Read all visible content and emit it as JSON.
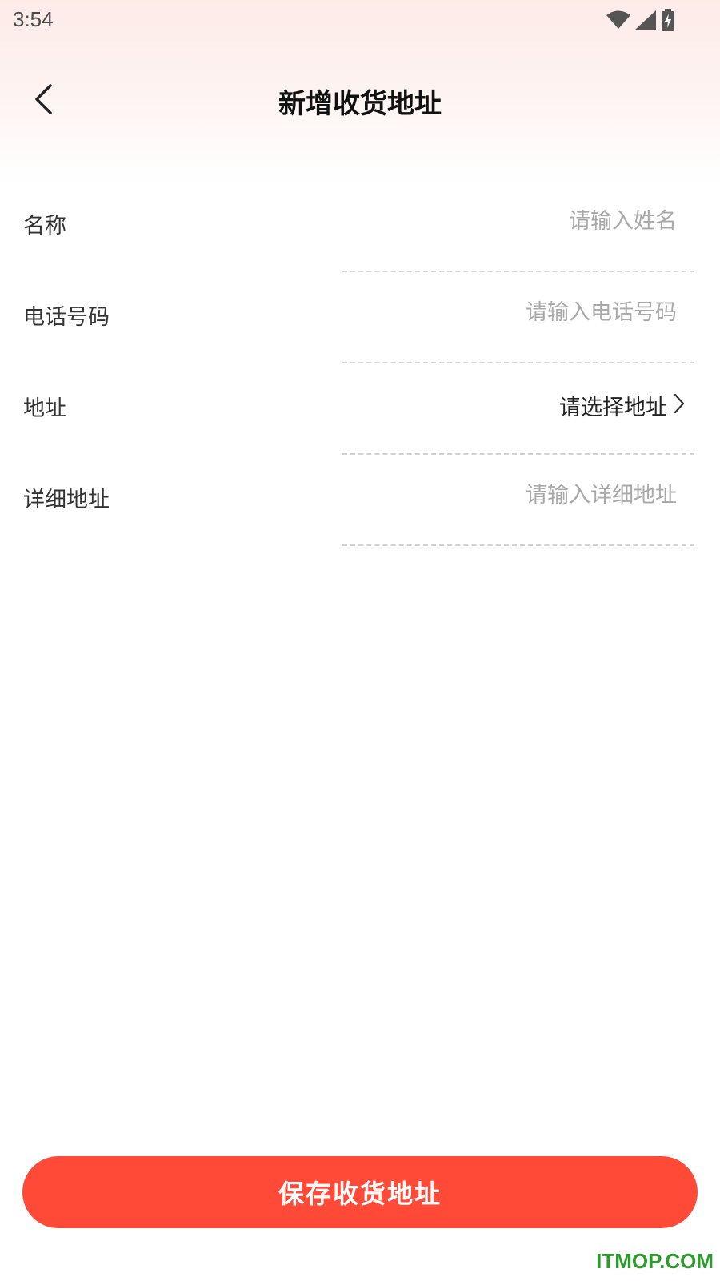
{
  "status_bar": {
    "time": "3:54",
    "icons": [
      "wifi-icon",
      "signal-icon",
      "battery-charging-icon"
    ]
  },
  "header": {
    "title": "新增收货地址",
    "back_icon": "chevron-left-icon"
  },
  "form": {
    "name": {
      "label": "名称",
      "placeholder": "请输入姓名",
      "value": ""
    },
    "phone": {
      "label": "电话号码",
      "placeholder": "请输入电话号码",
      "value": ""
    },
    "address": {
      "label": "地址",
      "select_text": "请选择地址",
      "icon": "chevron-right-icon"
    },
    "detail": {
      "label": "详细地址",
      "placeholder": "请输入详细地址",
      "value": ""
    }
  },
  "footer": {
    "save_label": "保存收货地址"
  },
  "watermark": "ITMOP.COM",
  "colors": {
    "accent": "#ff4a37",
    "placeholder": "#a8a8a8",
    "watermark": "#2e9b2e"
  }
}
